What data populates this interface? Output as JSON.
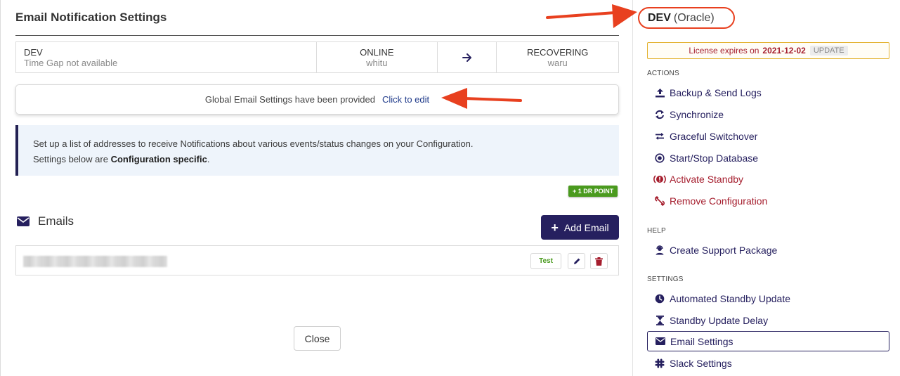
{
  "main": {
    "title": "Email Notification Settings",
    "status": {
      "primary_name": "DEV",
      "primary_sub": "Time Gap not available",
      "online_label": "ONLINE",
      "online_host": "whitu",
      "arrow_icon": "arrow-right-icon",
      "recovering_label": "RECOVERING",
      "recovering_host": "waru"
    },
    "global": {
      "text": "Global Email Settings have been provided",
      "link": "Click to edit"
    },
    "info": {
      "line1": "Set up a list of addresses to receive Notifications about various events/status changes on your Configuration.",
      "line2_prefix": "Settings below are ",
      "line2_bold": "Configuration specific",
      "line2_suffix": "."
    },
    "dr_badge": "+ 1 DR POINT",
    "emails_heading": "Emails",
    "add_email": "Add Email",
    "email_row": {
      "test_label": "Test"
    },
    "close_label": "Close"
  },
  "sidebar": {
    "title_name": "DEV",
    "title_db": "(Oracle)",
    "license_text": "License expires on",
    "license_date": "2021-12-02",
    "license_update": "UPDATE",
    "sections": {
      "actions": "ACTIONS",
      "help": "HELP",
      "settings": "SETTINGS"
    },
    "actions": [
      {
        "label": "Backup & Send Logs",
        "icon": "upload-icon"
      },
      {
        "label": "Synchronize",
        "icon": "sync-icon"
      },
      {
        "label": "Graceful Switchover",
        "icon": "switch-arrows-icon"
      },
      {
        "label": "Start/Stop Database",
        "icon": "record-icon"
      },
      {
        "label": "Activate Standby",
        "icon": "alert-icon"
      },
      {
        "label": "Remove Configuration",
        "icon": "unlink-icon"
      }
    ],
    "help": [
      {
        "label": "Create Support Package",
        "icon": "support-agent-icon"
      }
    ],
    "settings": [
      {
        "label": "Automated Standby Update",
        "icon": "clock-icon"
      },
      {
        "label": "Standby Update Delay",
        "icon": "hourglass-icon"
      },
      {
        "label": "Email Settings",
        "icon": "envelope-icon"
      },
      {
        "label": "Slack Settings",
        "icon": "slack-icon"
      }
    ]
  },
  "colors": {
    "accent": "#26205f",
    "danger": "#a51d2d",
    "success": "#4a9a1e",
    "annotation": "#e8401f"
  }
}
